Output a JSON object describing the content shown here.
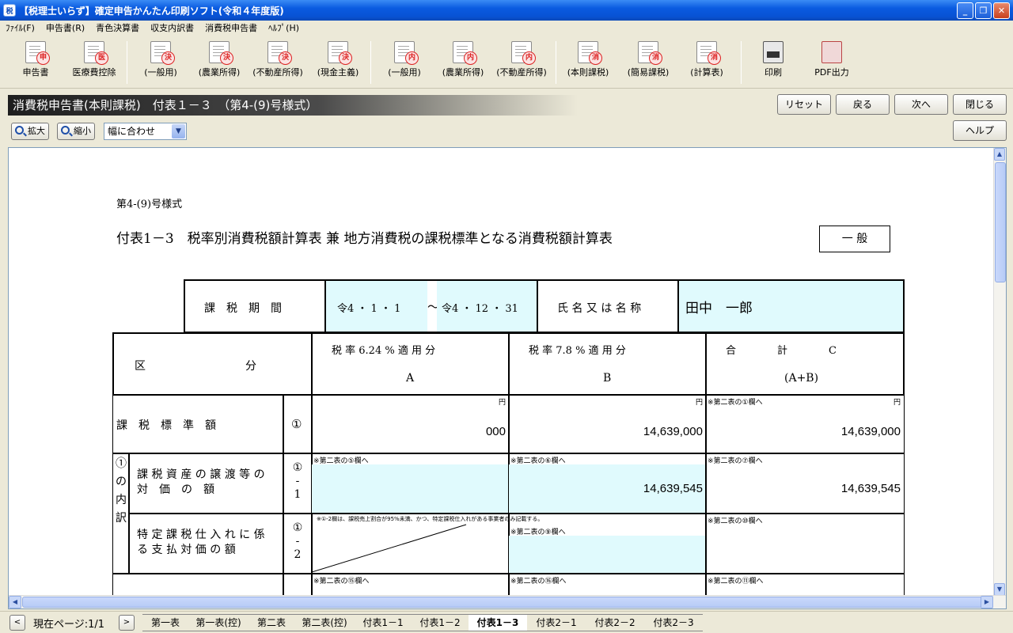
{
  "window": {
    "title": "【税理士いらず】確定申告かんたん印刷ソフト(令和４年度版)",
    "min": "_",
    "max": "❐",
    "close": "✕"
  },
  "menu": [
    "ﾌｧｲﾙ(F)",
    "申告書(R)",
    "青色決算書",
    "収支内訳書",
    "消費税申告書",
    "ﾍﾙﾌﾟ(H)"
  ],
  "toolbar": [
    {
      "label": "申告書",
      "stamp": "申"
    },
    {
      "label": "医療費控除",
      "stamp": "医"
    },
    {
      "label": "(一般用)",
      "stamp": "決"
    },
    {
      "label": "(農業所得)",
      "stamp": "決"
    },
    {
      "label": "(不動産所得)",
      "stamp": "決"
    },
    {
      "label": "(現金主義)",
      "stamp": "決"
    },
    {
      "label": "(一般用)",
      "stamp": "内"
    },
    {
      "label": "(農業所得)",
      "stamp": "内"
    },
    {
      "label": "(不動産所得)",
      "stamp": "内"
    },
    {
      "label": "(本則課税)",
      "stamp": "消"
    },
    {
      "label": "(簡易課税)",
      "stamp": "消"
    },
    {
      "label": "(計算表)",
      "stamp": "消"
    },
    {
      "label": "印刷",
      "stamp": ""
    },
    {
      "label": "PDF出力",
      "stamp": ""
    }
  ],
  "header": {
    "title": "消費税申告書(本則課税)　付表１－３　（第4-(9)号様式）",
    "reset": "リセット",
    "back": "戻る",
    "next": "次へ",
    "close": "閉じる",
    "help": "ヘルプ"
  },
  "zoom": {
    "in": "拡大",
    "out": "縮小",
    "fit": "幅に合わせ"
  },
  "form": {
    "form_no": "第4-(9)号様式",
    "title": "付表1－3　税率別消費税額計算表 兼 地方消費税の課税標準となる消費税額計算表",
    "type": "一 般",
    "period_label": "課　税　期　間",
    "period_from": "令4 ・ 1 ・ 1",
    "period_tilde": "～",
    "period_to": "令4 ・ 12 ・ 31",
    "name_label": "氏 名 又 は 名 称",
    "name_value": "田中　一郎",
    "col_kubun": "区　　　　　　　　　分",
    "col_a_head": "税 率 6.24 % 適 用 分",
    "col_a_letter": "A",
    "col_b_head": "税 率 7.8 % 適 用 分",
    "col_b_letter": "B",
    "col_c_head": "合　　　　計　　　　C",
    "col_c_sub": "(A+B)",
    "yen": "円",
    "row1_label": "課　税　標　準　額",
    "row1_no": "①",
    "row1_a": "000",
    "row1_b": "14,639,000",
    "row1_c": "14,639,000",
    "row1_c_note": "※第二表の①欄へ",
    "side_label": "① の 内 訳",
    "row11_label": "課 税 資 産 の 譲 渡 等 の　対　価　の　額",
    "row11_no": "① ‐ 1",
    "row11_a_note": "※第二表の⑤欄へ",
    "row11_b_note": "※第二表の⑥欄へ",
    "row11_c_note": "※第二表の⑦欄へ",
    "row11_b": "14,639,545",
    "row11_c": "14,639,545",
    "row12_label": "特 定 課 税 仕 入 れ に 係 る 支 払 対 価 の 額",
    "row12_no": "① ‐ 2",
    "row12_a_note": "※①-2欄は、課税売上割合が95%未満、かつ、特定課税仕入れがある事業者のみ記載する。",
    "row12_b_note": "※第二表の⑨欄へ",
    "row12_c_note": "※第二表の⑩欄へ",
    "row2_a_note": "※第二表の⑮欄へ",
    "row2_b_note": "※第二表の⑯欄へ",
    "row2_c_note": "※第二表の⑪欄へ"
  },
  "pager": {
    "label": "現在ページ:1/1",
    "prev": "<",
    "next": ">"
  },
  "tabs": [
    "第一表",
    "第一表(控)",
    "第二表",
    "第二表(控)",
    "付表1－1",
    "付表1－2",
    "付表1－3",
    "付表2－1",
    "付表2－2",
    "付表2－3"
  ],
  "active_tab": "付表1－3"
}
